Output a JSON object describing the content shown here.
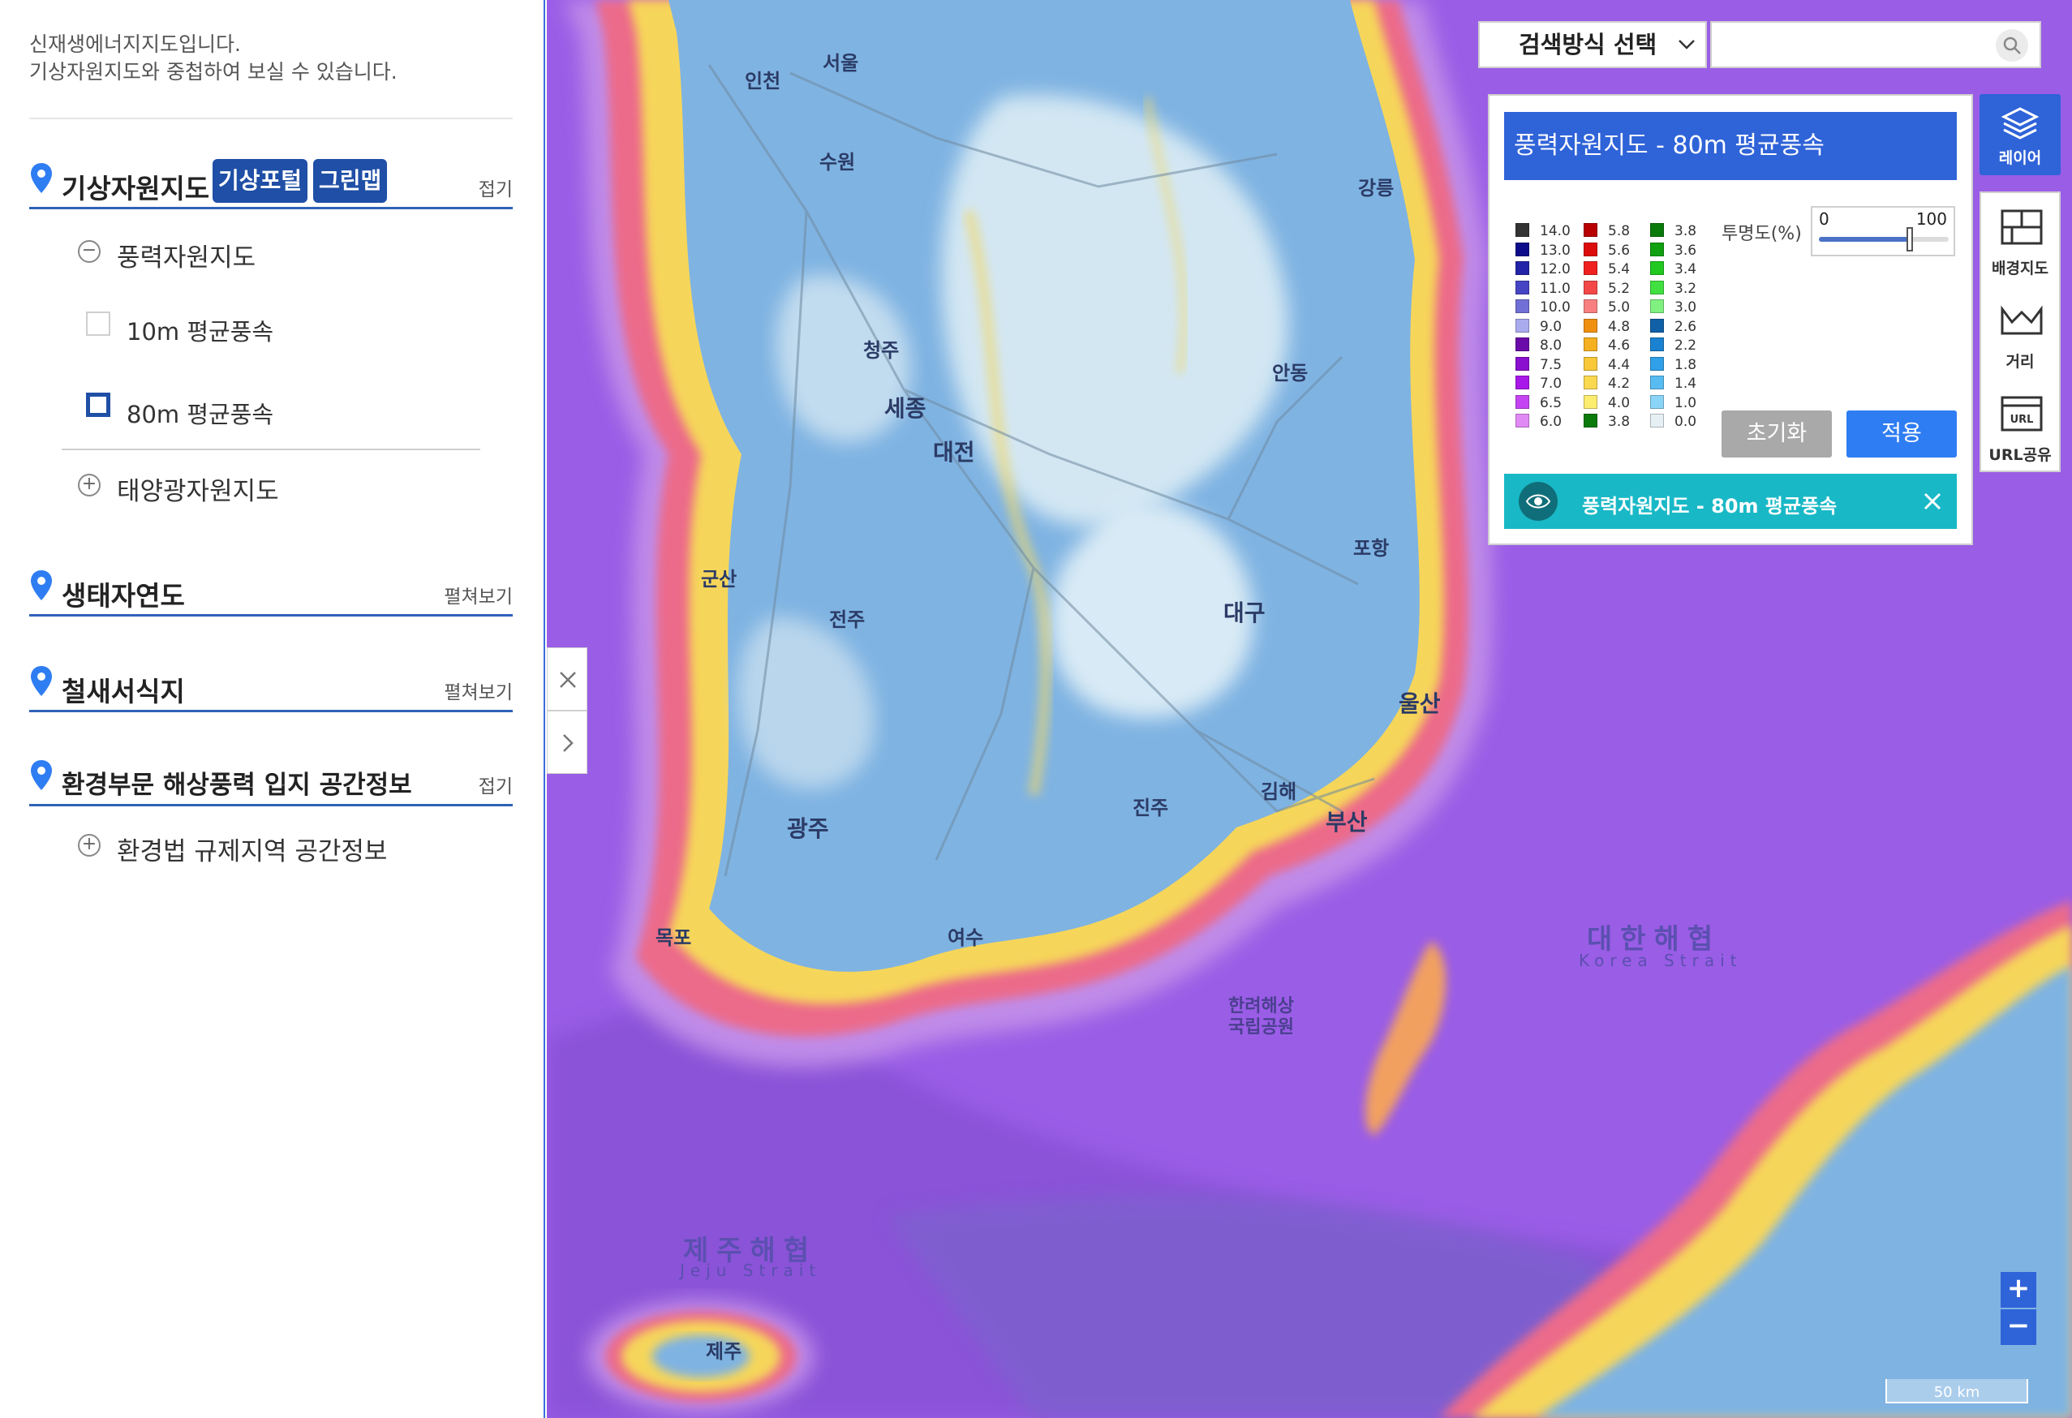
{
  "intro": {
    "line1": "신재생에너지지도입니다.",
    "line2": "기상자원지도와 중첩하여 보실 수 있습니다."
  },
  "sections": {
    "weather": {
      "title": "기상자원지도",
      "tag1": "기상포털",
      "tag2": "그린맵",
      "toggle": "접기",
      "wind": "풍력자원지도",
      "wind10": "10m 평균풍속",
      "wind80": "80m 평균풍속",
      "solar": "태양광자원지도"
    },
    "eco": {
      "title": "생태자연도",
      "toggle": "펼쳐보기"
    },
    "bird": {
      "title": "철새서식지",
      "toggle": "펼쳐보기"
    },
    "offshore": {
      "title": "환경부문 해상풍력 입지 공간정보",
      "toggle": "접기",
      "law": "환경법 규제지역 공간정보"
    }
  },
  "search": {
    "select_label": "검색방식 선택",
    "placeholder": ""
  },
  "legend": {
    "title": "풍력자원지도 - 80m 평균풍속",
    "col1": [
      {
        "label": "14.0",
        "color": "#333333"
      },
      {
        "label": "13.0",
        "color": "#0c0c8a"
      },
      {
        "label": "12.0",
        "color": "#2323a8"
      },
      {
        "label": "11.0",
        "color": "#4545c4"
      },
      {
        "label": "10.0",
        "color": "#7070d6"
      },
      {
        "label": "9.0",
        "color": "#aaaaee"
      },
      {
        "label": "8.0",
        "color": "#6a0aa8"
      },
      {
        "label": "7.5",
        "color": "#8a10cf"
      },
      {
        "label": "7.0",
        "color": "#a818e8"
      },
      {
        "label": "6.5",
        "color": "#c544f2"
      },
      {
        "label": "6.0",
        "color": "#e08af5"
      }
    ],
    "col2": [
      {
        "label": "5.8",
        "color": "#b80000"
      },
      {
        "label": "5.6",
        "color": "#dd0c0c"
      },
      {
        "label": "5.4",
        "color": "#f02020"
      },
      {
        "label": "5.2",
        "color": "#f44848"
      },
      {
        "label": "5.0",
        "color": "#f88080"
      },
      {
        "label": "4.8",
        "color": "#f09010"
      },
      {
        "label": "4.6",
        "color": "#f5b020"
      },
      {
        "label": "4.4",
        "color": "#f8c838"
      },
      {
        "label": "4.2",
        "color": "#fad850"
      },
      {
        "label": "4.0",
        "color": "#fcec70"
      },
      {
        "label": "3.8",
        "color": "#0a7a0a"
      }
    ],
    "col3": [
      {
        "label": "3.8",
        "color": "#0a7a0a"
      },
      {
        "label": "3.6",
        "color": "#10a010"
      },
      {
        "label": "3.4",
        "color": "#20c820"
      },
      {
        "label": "3.2",
        "color": "#40e040"
      },
      {
        "label": "3.0",
        "color": "#80f080"
      },
      {
        "label": "2.6",
        "color": "#1060a8"
      },
      {
        "label": "2.2",
        "color": "#1a82d0"
      },
      {
        "label": "1.8",
        "color": "#30a0e8"
      },
      {
        "label": "1.4",
        "color": "#58bcf2"
      },
      {
        "label": "1.0",
        "color": "#8ad4f8"
      },
      {
        "label": "0.0",
        "color": "#e6f0f4"
      }
    ],
    "opacity_label": "투명도(%)",
    "opacity_min": "0",
    "opacity_max": "100",
    "opacity_value": 70,
    "reset": "초기화",
    "apply": "적용",
    "active_layer": "풍력자원지도 - 80m 평균풍속"
  },
  "toolbar": {
    "layer": "레이어",
    "basemap": "배경지도",
    "distance": "거리",
    "url": "URL공유"
  },
  "map": {
    "zoom_in": "+",
    "zoom_out": "−",
    "scale": "50 km",
    "labels": {
      "seoul": "서울",
      "incheon": "인천",
      "sejong": "세종",
      "daejeon": "대전",
      "daegu": "대구",
      "ulsan": "울산",
      "busan": "부산",
      "gwangju": "광주",
      "jeonju": "전주",
      "cheongju": "청주",
      "andong": "안동",
      "pohang": "포항",
      "mokpo": "목포",
      "yeosu": "여수",
      "jinju": "진주",
      "gimhae": "김해",
      "suwon": "수원",
      "gangneung": "강릉",
      "gunsan": "군산",
      "korea_strait_ko": "대한해협",
      "korea_strait_en": "Korea Strait",
      "jeju_strait_ko": "제주해협",
      "jeju_strait_en": "Jeju Strait",
      "hallyeo": "한려해상",
      "hallyeo2": "국립공원",
      "jeju": "제주"
    }
  },
  "colors": {
    "accent": "#2f63d8",
    "teal": "#19b8c6",
    "section_line": "#2f63b8"
  }
}
